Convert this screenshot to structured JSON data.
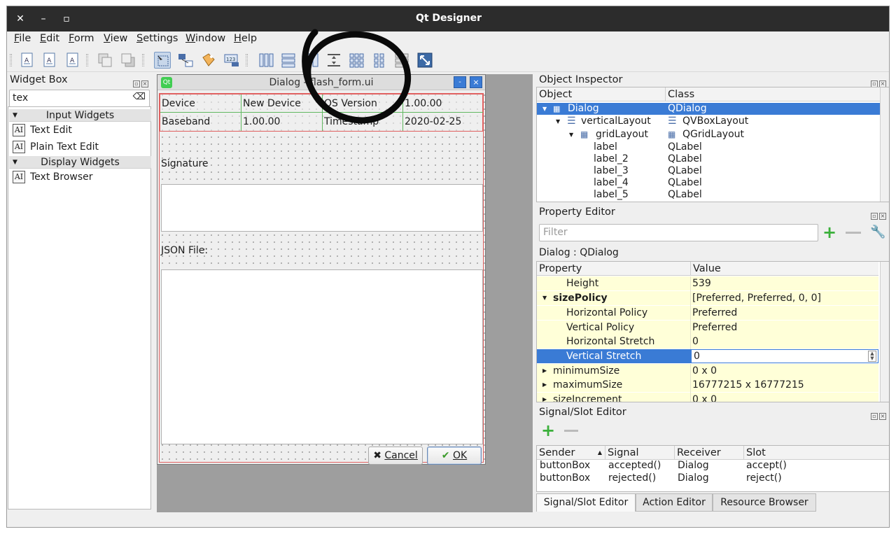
{
  "window": {
    "title": "Qt Designer",
    "close_glyph": "✕",
    "minimize_glyph": "–",
    "maximize_glyph": "▫"
  },
  "menubar": [
    {
      "label": "File",
      "accel": "F",
      "rest": "ile"
    },
    {
      "label": "Edit",
      "accel": "E",
      "rest": "dit"
    },
    {
      "label": "Form",
      "accel": "F",
      "rest": "orm"
    },
    {
      "label": "View",
      "accel": "V",
      "rest": "iew"
    },
    {
      "label": "Settings",
      "accel": "S",
      "rest": "ettings"
    },
    {
      "label": "Window",
      "accel": "W",
      "rest": "indow"
    },
    {
      "label": "Help",
      "accel": "H",
      "rest": "elp"
    }
  ],
  "toolbar_icons": [
    "new-form-icon",
    "open-form-icon",
    "save-form-icon",
    "send-to-back-icon",
    "bring-to-front-icon",
    "edit-widgets-icon",
    "edit-signals-slots-icon",
    "edit-buddies-icon",
    "edit-tab-order-icon",
    "layout-horizontal-icon",
    "layout-vertical-icon",
    "layout-h-splitter-icon",
    "layout-v-splitter-icon",
    "layout-grid-icon",
    "layout-form-icon",
    "break-layout-icon",
    "adjust-size-icon"
  ],
  "widget_box": {
    "title": "Widget Box",
    "filter_value": "tex",
    "clear_glyph": "⌫",
    "categories": [
      {
        "label": "Input Widgets",
        "items": [
          "Text Edit",
          "Plain Text Edit"
        ]
      },
      {
        "label": "Display Widgets",
        "items": [
          "Text Browser"
        ]
      }
    ],
    "item_icon_text": "AI"
  },
  "form": {
    "title": "Dialog - flash_form.ui",
    "grid": [
      [
        "Device",
        "New Device",
        "OS Version",
        "1.00.00"
      ],
      [
        "Baseband",
        "1.00.00",
        "Timestamp",
        "2020-02-25"
      ]
    ],
    "signature_label": "Signature",
    "json_label": "JSON File:",
    "cancel_label": "Cancel",
    "ok_label": "OK",
    "cancel_glyph": "✖",
    "ok_glyph": "✔"
  },
  "object_inspector": {
    "title": "Object Inspector",
    "columns": [
      "Object",
      "Class"
    ],
    "rows": [
      {
        "object": "Dialog",
        "class": "QDialog",
        "selected": true
      },
      {
        "object": "verticalLayout",
        "class": "QVBoxLayout"
      },
      {
        "object": "gridLayout",
        "class": "QGridLayout"
      },
      {
        "object": "label",
        "class": "QLabel"
      },
      {
        "object": "label_2",
        "class": "QLabel"
      },
      {
        "object": "label_3",
        "class": "QLabel"
      },
      {
        "object": "label_4",
        "class": "QLabel"
      },
      {
        "object": "label_5",
        "class": "QLabel"
      }
    ]
  },
  "property_editor": {
    "title": "Property Editor",
    "filter_placeholder": "Filter",
    "context": "Dialog : QDialog",
    "columns": [
      "Property",
      "Value"
    ],
    "rows": [
      {
        "name": "Height",
        "value": "539"
      },
      {
        "name": "sizePolicy",
        "value": "[Preferred, Preferred, 0, 0]"
      },
      {
        "name": "Horizontal Policy",
        "value": "Preferred"
      },
      {
        "name": "Vertical Policy",
        "value": "Preferred"
      },
      {
        "name": "Horizontal Stretch",
        "value": "0"
      },
      {
        "name": "Vertical Stretch",
        "value": "0"
      },
      {
        "name": "minimumSize",
        "value": "0 x 0"
      },
      {
        "name": "maximumSize",
        "value": "16777215 x 16777215"
      },
      {
        "name": "sizeIncrement",
        "value": "0 x 0"
      }
    ]
  },
  "signal_slot_editor": {
    "title": "Signal/Slot Editor",
    "columns": [
      "Sender",
      "Signal",
      "Receiver",
      "Slot"
    ],
    "rows": [
      [
        "buttonBox",
        "accepted()",
        "Dialog",
        "accept()"
      ],
      [
        "buttonBox",
        "rejected()",
        "Dialog",
        "reject()"
      ]
    ]
  },
  "tabs": [
    "Signal/Slot Editor",
    "Action Editor",
    "Resource Browser"
  ],
  "colors": {
    "titlebar": "#2c2c2c",
    "selection": "#3a7bd5",
    "property_highlight": "#ffffd8",
    "grid_border": "#61b861",
    "layout_border": "#e06060"
  }
}
